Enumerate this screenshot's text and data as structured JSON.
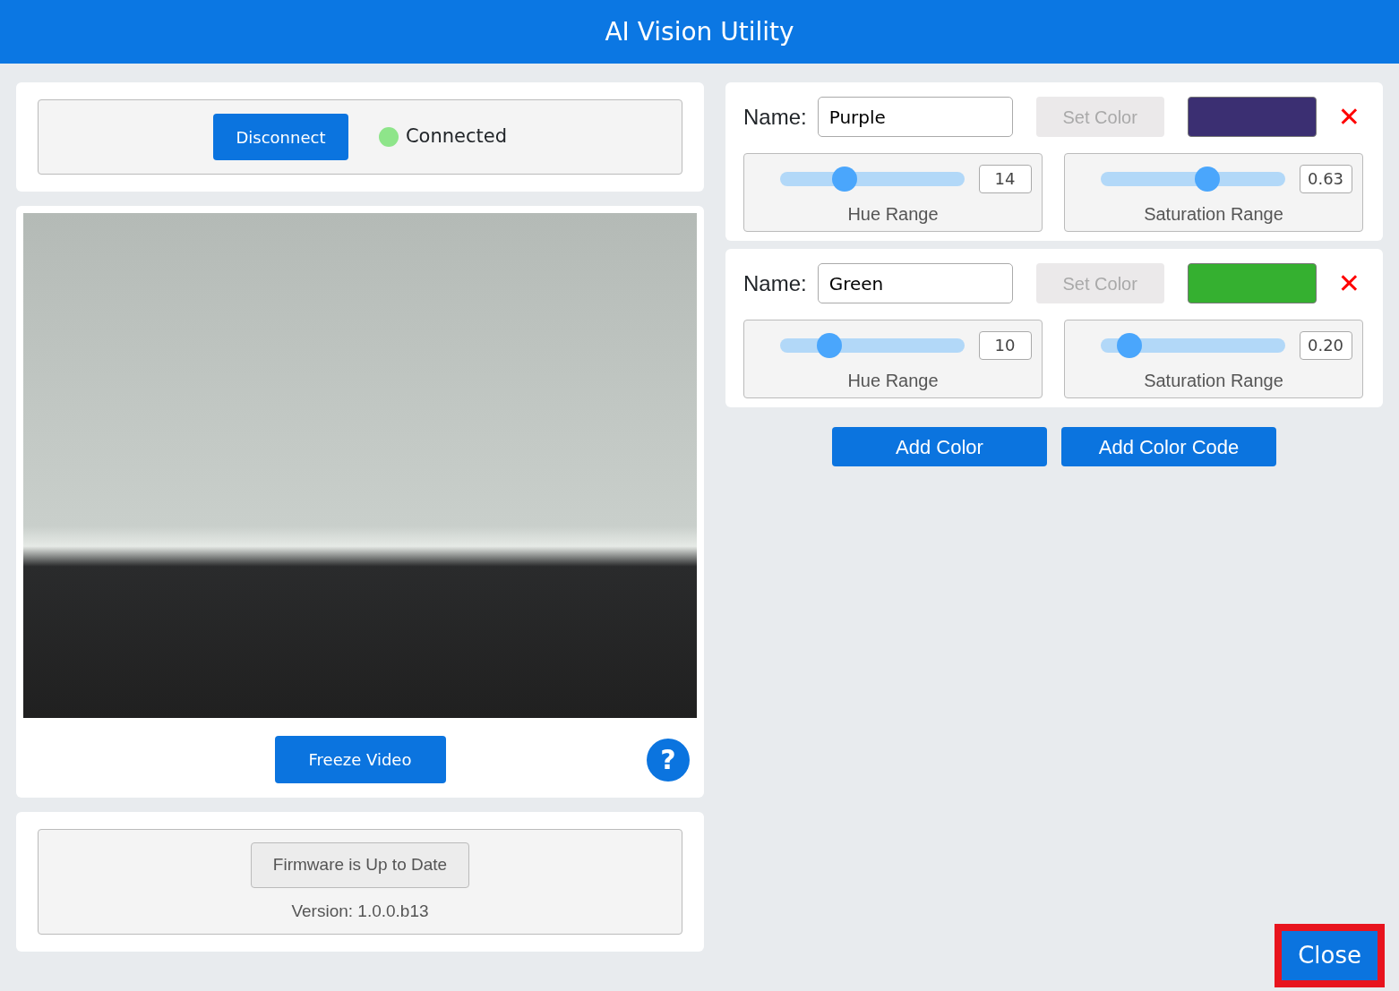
{
  "header": {
    "title": "AI Vision Utility"
  },
  "connection": {
    "button": "Disconnect",
    "status": "Connected",
    "connected": true
  },
  "video": {
    "freeze_button": "Freeze Video",
    "help": "?"
  },
  "firmware": {
    "button": "Firmware is Up to Date",
    "version": "Version: 1.0.0.b13"
  },
  "colors": [
    {
      "name_label": "Name:",
      "name": "Purple",
      "set_button": "Set Color",
      "disabled": true,
      "color": "#3b2f72",
      "delete": "✕",
      "hue": {
        "level": 0.35,
        "reading": "14",
        "label": "Hue Range"
      },
      "saturation": {
        "level": 0.58,
        "reading": "0.63",
        "label": "Saturation Range"
      }
    },
    {
      "name_label": "Name:",
      "name": "Green",
      "set_button": "Set Color",
      "disabled": true,
      "color": "#35b030",
      "delete": "✕",
      "hue": {
        "level": 0.27,
        "reading": "10",
        "label": "Hue Range"
      },
      "saturation": {
        "level": 0.16,
        "reading": "0.20",
        "label": "Saturation Range"
      }
    }
  ],
  "actions": [
    "Add Color",
    "Add Color Code"
  ],
  "close_button": "Close"
}
